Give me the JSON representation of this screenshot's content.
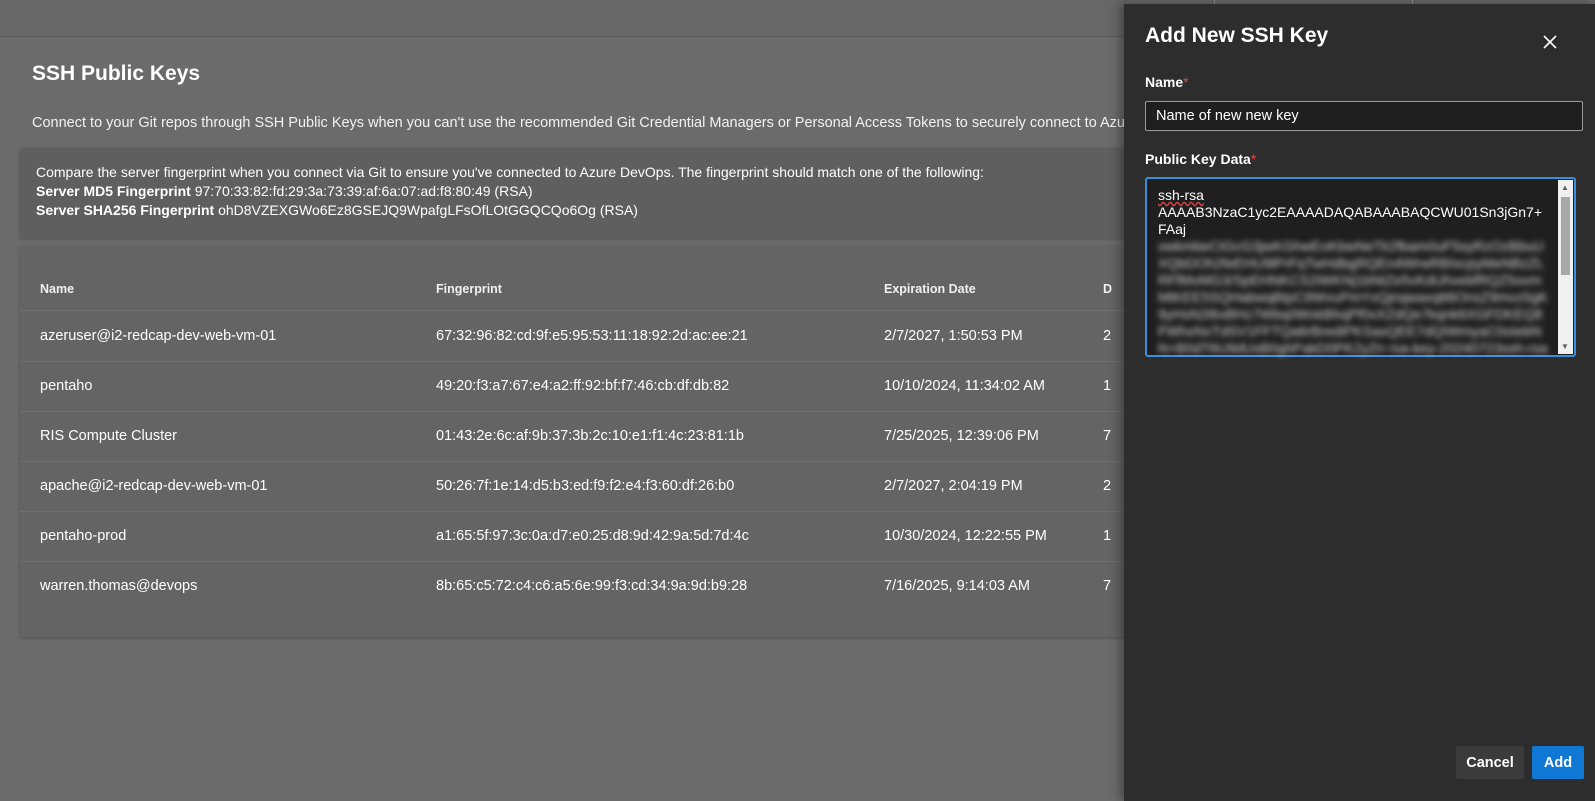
{
  "page": {
    "title": "SSH Public Keys",
    "description": "Connect to your Git repos through SSH Public Keys when you can't use the recommended Git Credential Managers or Personal Access Tokens to securely connect to Azure DevOps"
  },
  "fingerprint_info": {
    "intro": "Compare the server fingerprint when you connect via Git to ensure you've connected to Azure DevOps. The fingerprint should match one of the following:",
    "md5_label": "Server MD5 Fingerprint",
    "md5_value": "97:70:33:82:fd:29:3a:73:39:af:6a:07:ad:f8:80:49 (RSA)",
    "sha256_label": "Server SHA256 Fingerprint",
    "sha256_value": "ohD8VZEXGWo6Ez8GSEJQ9WpafgLFsOfLOtGGQCQo6Og (RSA)"
  },
  "table": {
    "headers": {
      "name": "Name",
      "fingerprint": "Fingerprint",
      "expiration": "Expiration Date",
      "d": "D"
    },
    "rows": [
      {
        "name": "azeruser@i2-redcap-dev-web-vm-01",
        "fingerprint": "67:32:96:82:cd:9f:e5:95:53:11:18:92:2d:ac:ee:21",
        "expiration": "2/7/2027, 1:50:53 PM",
        "d": "2"
      },
      {
        "name": "pentaho",
        "fingerprint": "49:20:f3:a7:67:e4:a2:ff:92:bf:f7:46:cb:df:db:82",
        "expiration": "10/10/2024, 11:34:02 AM",
        "d": "1"
      },
      {
        "name": "RIS Compute Cluster",
        "fingerprint": "01:43:2e:6c:af:9b:37:3b:2c:10:e1:f1:4c:23:81:1b",
        "expiration": "7/25/2025, 12:39:06 PM",
        "d": "7"
      },
      {
        "name": "apache@i2-redcap-dev-web-vm-01",
        "fingerprint": "50:26:7f:1e:14:d5:b3:ed:f9:f2:e4:f3:60:df:26:b0",
        "expiration": "2/7/2027, 2:04:19 PM",
        "d": "2"
      },
      {
        "name": "pentaho-prod",
        "fingerprint": "a1:65:5f:97:3c:0a:d7:e0:25:d8:9d:42:9a:5d:7d:4c",
        "expiration": "10/30/2024, 12:22:55 PM",
        "d": "1"
      },
      {
        "name": "warren.thomas@devops",
        "fingerprint": "8b:65:c5:72:c4:c6:a5:6e:99:f3:cd:34:9a:9d:b9:28",
        "expiration": "7/16/2025, 9:14:03 AM",
        "d": "7"
      }
    ]
  },
  "panel": {
    "title": "Add New SSH Key",
    "close_icon": "close-icon",
    "name_label": "Name",
    "name_value": "Name of new new key",
    "required_marker": "*",
    "key_label": "Public Key Data",
    "key_line1": "ssh-rsa",
    "key_line2": "AAAAB3NzaC1yc2EAAAADAQABAAABAQCWU01Sn3jGn7+FAaj",
    "key_blurred": "xwkmbeCtGcG3jwKGhwEoKbwNeTk2fbam0uF5syRzOzBbuUXQbDOh2feEHU9lPrFqTwHdbgRQEn4WrwRBIscpyMeNBzZLRFfMvMG3/SpEHNKCS2iWKNj1bNtZe5vKdUhvebfRQZ5ovmMtKEE5SQHabwqBtpC9WvuPmYxQjnqwaxqtt6OnsZ9mvz5gK9yHsN2l6xBHz7Wbq0WxkBhqPf0xXZdQe7kqnk6XGFDKEQ8FWhxNxTdSV1FFTQa6rBrediPKSaxQEE7dQIWmyaC0oIebNN+B0dT6U9dUsB0ghPakD0PK2yZn rsa-key-20240723ssh-rsa"
  },
  "buttons": {
    "cancel": "Cancel",
    "add": "Add"
  },
  "colors": {
    "primary": "#0f78d4",
    "focus_border": "#3a8ee0",
    "required": "#e04a4a"
  }
}
